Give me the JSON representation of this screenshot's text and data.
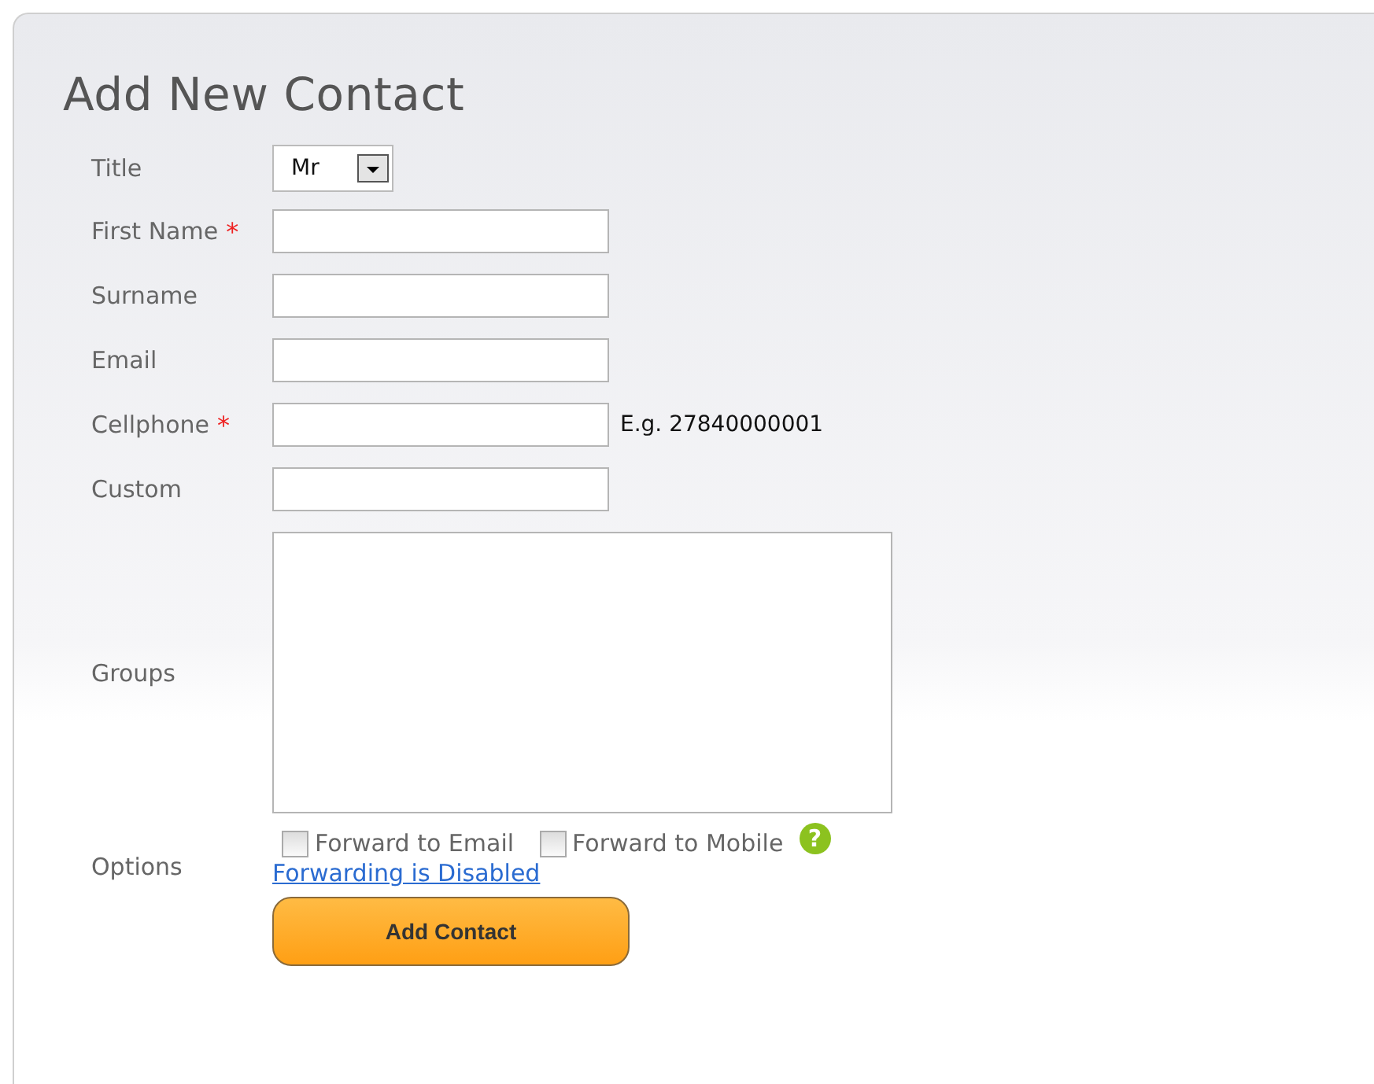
{
  "heading": "Add New Contact",
  "fields": [
    {
      "kind": "select",
      "label": "Title",
      "required": false,
      "value": "Mr"
    },
    {
      "kind": "text",
      "label": "First Name",
      "required": true
    },
    {
      "kind": "text",
      "label": "Surname",
      "required": false
    },
    {
      "kind": "text",
      "label": "Email",
      "required": false
    },
    {
      "kind": "text",
      "label": "Cellphone",
      "required": true,
      "hint": "E.g. 27840000001"
    },
    {
      "kind": "text",
      "label": "Custom",
      "required": false
    },
    {
      "kind": "list",
      "label": "Groups",
      "required": false
    }
  ],
  "required_mark": "*",
  "options": {
    "label": "Options",
    "checkboxes": [
      {
        "label": "Forward to Email",
        "checked": false
      },
      {
        "label": "Forward to Mobile",
        "checked": false
      }
    ],
    "help_icon": "?",
    "link": "Forwarding is Disabled"
  },
  "submit": "Add Contact"
}
